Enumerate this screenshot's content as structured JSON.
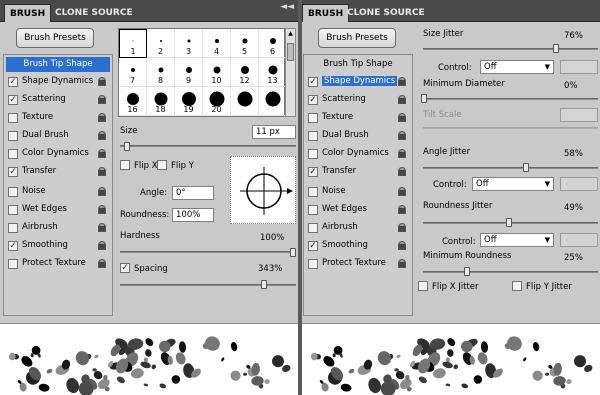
{
  "left": {
    "tabs": [
      "BRUSH",
      "CLONE SOURCE"
    ],
    "presets_button": "Brush Presets",
    "side_items": [
      {
        "label": "Brush Tip Shape",
        "header": true,
        "selected": true
      },
      {
        "label": "Shape Dynamics",
        "checked": true
      },
      {
        "label": "Scattering",
        "checked": true
      },
      {
        "label": "Texture",
        "checked": false
      },
      {
        "label": "Dual Brush",
        "checked": false
      },
      {
        "label": "Color Dynamics",
        "checked": false
      },
      {
        "label": "Transfer",
        "checked": true
      },
      {
        "label": "Noise",
        "checked": false
      },
      {
        "label": "Wet Edges",
        "checked": false
      },
      {
        "label": "Airbrush",
        "checked": false
      },
      {
        "label": "Smoothing",
        "checked": true
      },
      {
        "label": "Protect Texture",
        "checked": false
      }
    ],
    "brushes": [
      {
        "n": "1",
        "size": 1,
        "selected": true
      },
      {
        "n": "2",
        "size": 2
      },
      {
        "n": "3",
        "size": 3
      },
      {
        "n": "4",
        "size": 4
      },
      {
        "n": "5",
        "size": 5
      },
      {
        "n": "6",
        "size": 6
      },
      {
        "n": "7",
        "size": 4
      },
      {
        "n": "8",
        "size": 5
      },
      {
        "n": "9",
        "size": 6
      },
      {
        "n": "10",
        "size": 7
      },
      {
        "n": "12",
        "size": 8
      },
      {
        "n": "13",
        "size": 9
      },
      {
        "n": "16",
        "size": 12
      },
      {
        "n": "18",
        "size": 13
      },
      {
        "n": "19",
        "size": 14
      },
      {
        "n": "20",
        "size": 15
      },
      {
        "n": "",
        "size": 15
      },
      {
        "n": "",
        "size": 15
      }
    ],
    "size_label": "Size",
    "size_value": "11 px",
    "flipx": "Flip X",
    "flipy": "Flip Y",
    "angle_label": "Angle:",
    "angle_value": "0°",
    "roundness_label": "Roundness:",
    "roundness_value": "100%",
    "hardness_label": "Hardness",
    "hardness_value": "100%",
    "spacing_label": "Spacing",
    "spacing_value": "343%"
  },
  "right": {
    "tabs": [
      "BRUSH",
      "CLONE SOURCE"
    ],
    "presets_button": "Brush Presets",
    "side_items": [
      {
        "label": "Brush Tip Shape",
        "header": true,
        "selected": false
      },
      {
        "label": "Shape Dynamics",
        "checked": true,
        "selected": true
      },
      {
        "label": "Scattering",
        "checked": true
      },
      {
        "label": "Texture",
        "checked": false
      },
      {
        "label": "Dual Brush",
        "checked": false
      },
      {
        "label": "Color Dynamics",
        "checked": false
      },
      {
        "label": "Transfer",
        "checked": true
      },
      {
        "label": "Noise",
        "checked": false
      },
      {
        "label": "Wet Edges",
        "checked": false
      },
      {
        "label": "Airbrush",
        "checked": false
      },
      {
        "label": "Smoothing",
        "checked": true
      },
      {
        "label": "Protect Texture",
        "checked": false
      }
    ],
    "size_jitter_label": "Size Jitter",
    "size_jitter_value": "76%",
    "control_label": "Control:",
    "control_value": "Off",
    "min_diameter_label": "Minimum Diameter",
    "min_diameter_value": "0%",
    "tilt_scale_label": "Tilt Scale",
    "angle_jitter_label": "Angle Jitter",
    "angle_jitter_value": "58%",
    "control2_value": "Off",
    "roundness_jitter_label": "Roundness Jitter",
    "roundness_jitter_value": "49%",
    "control3_value": "Off",
    "min_roundness_label": "Minimum Roundness",
    "min_roundness_value": "25%",
    "flipx_jitter": "Flip X Jitter",
    "flipy_jitter": "Flip Y Jitter"
  }
}
